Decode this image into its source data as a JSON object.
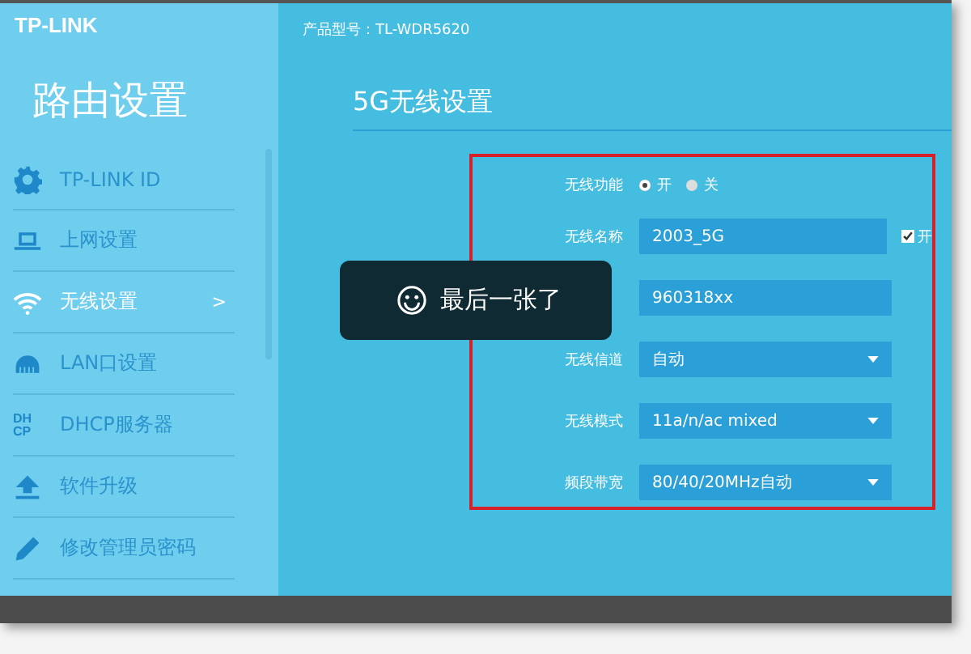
{
  "logo": "TP-LINK",
  "sidebar": {
    "title": "路由设置",
    "items": [
      {
        "label": "TP-LINK ID",
        "kind": "gear",
        "selected": false
      },
      {
        "label": "上网设置",
        "kind": "laptop",
        "selected": false
      },
      {
        "label": "无线设置",
        "kind": "wifi",
        "selected": true,
        "arrow": ">"
      },
      {
        "label": "LAN口设置",
        "kind": "lan",
        "selected": false
      },
      {
        "label": "DHCP服务器",
        "kind": "letters",
        "icon_text": [
          "DH",
          "CP"
        ],
        "selected": false
      },
      {
        "label": "软件升级",
        "kind": "upload",
        "selected": false
      },
      {
        "label": "修改管理员密码",
        "kind": "pencil",
        "selected": false
      }
    ]
  },
  "model": "产品型号：TL-WDR5620",
  "heading": "5G无线设置",
  "form": {
    "rows": [
      {
        "kind": "radio",
        "label": "无线功能",
        "options": [
          {
            "label": "开",
            "selected": true
          },
          {
            "label": "关",
            "selected": false
          }
        ]
      },
      {
        "kind": "text",
        "label": "无线名称",
        "value": "2003_5G",
        "checkbox": {
          "label": "开",
          "checked": true
        }
      },
      {
        "kind": "text",
        "value": "960318xx"
      },
      {
        "kind": "dropdown",
        "label": "无线信道",
        "value": "自动"
      },
      {
        "kind": "dropdown",
        "label": "无线模式",
        "value": "11a/n/ac mixed"
      },
      {
        "kind": "dropdown",
        "label": "频段带宽",
        "value": "80/40/20MHz自动"
      }
    ]
  },
  "toast": {
    "text": "最后一张了"
  }
}
